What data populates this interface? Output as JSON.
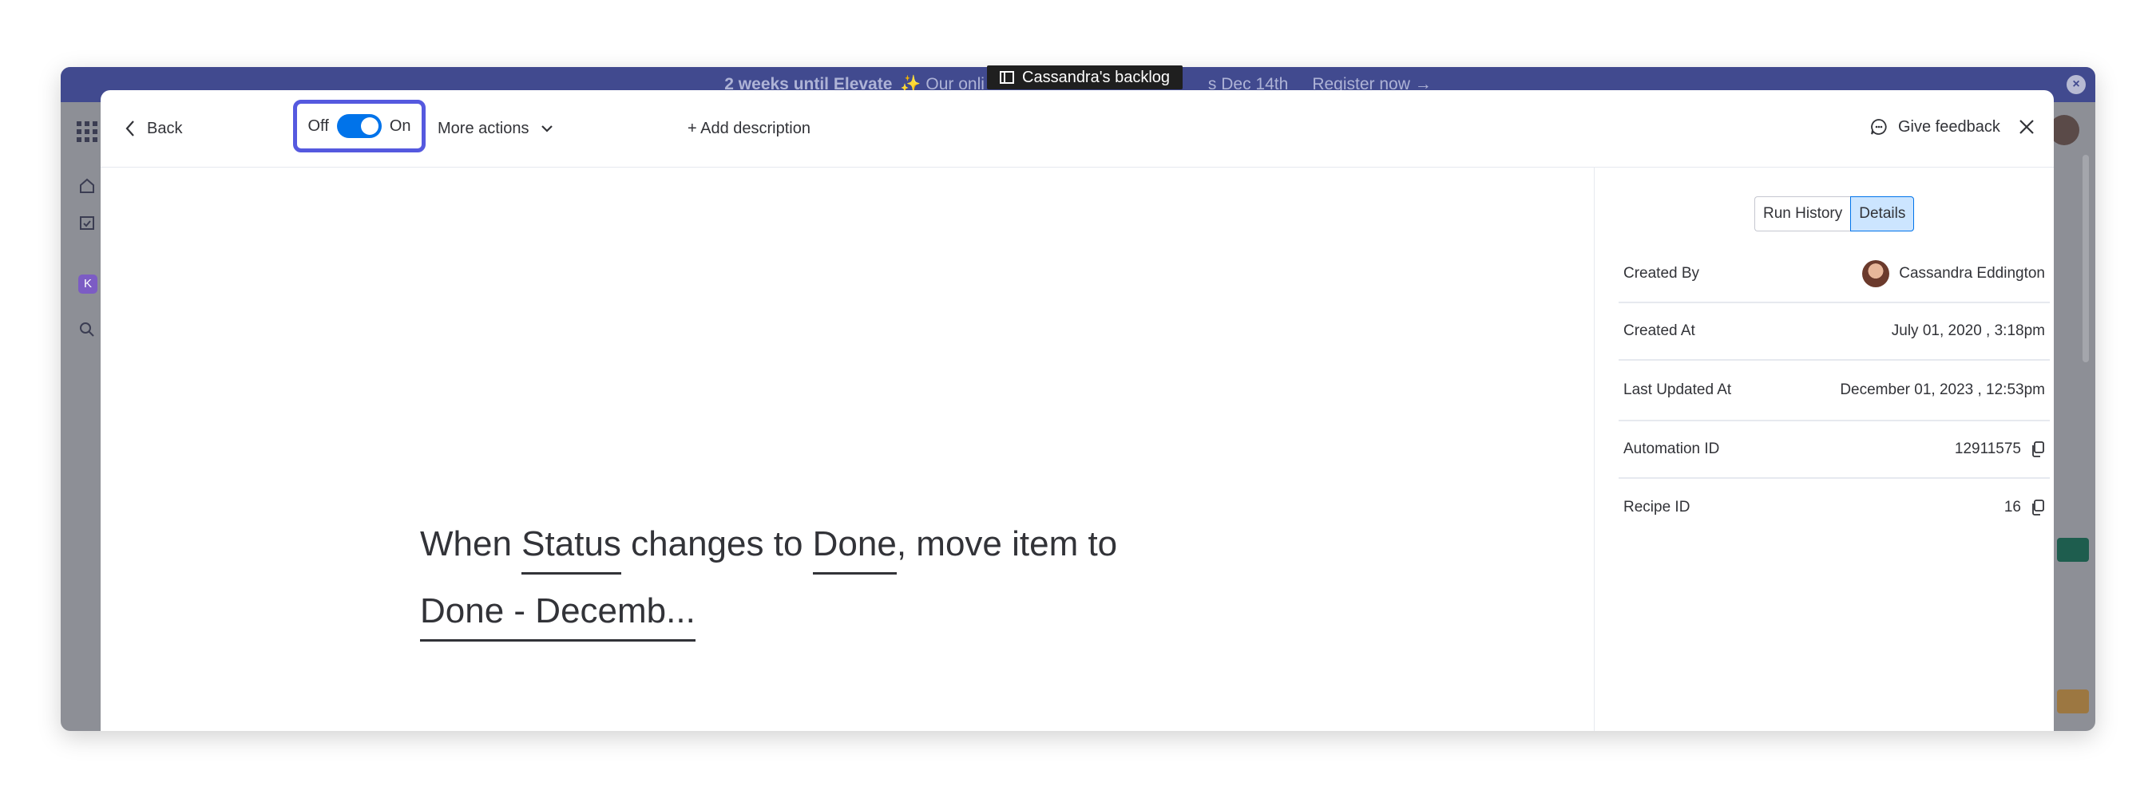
{
  "promo_banner": {
    "bold_text": "2 weeks until Elevate",
    "text": "✨ Our onli",
    "text_tail": "s Dec 14th",
    "register": "Register now →"
  },
  "board_tab": {
    "label": "Cassandra's backlog"
  },
  "header": {
    "back_label": "Back",
    "toggle_off_label": "Off",
    "toggle_on_label": "On",
    "toggle_state": "on",
    "more_actions_label": "More actions",
    "add_description_label": "+ Add description",
    "feedback_label": "Give feedback"
  },
  "recipe": {
    "part1": "When ",
    "trigger_column": "Status",
    "part2": " changes to ",
    "trigger_value": "Done",
    "part3": ", move item to",
    "target_group": "Done - Decemb..."
  },
  "details_panel": {
    "tabs": [
      {
        "label": "Run History",
        "active": false
      },
      {
        "label": "Details",
        "active": true
      }
    ],
    "rows": [
      {
        "label": "Created By",
        "value": "Cassandra Eddington"
      },
      {
        "label": "Created At",
        "value": "July 01, 2020 , 3:18pm"
      },
      {
        "label": "Last Updated At",
        "value": "December 01, 2023 , 12:53pm"
      },
      {
        "label": "Automation ID",
        "value": "12911575"
      },
      {
        "label": "Recipe ID",
        "value": "16"
      }
    ]
  },
  "colors": {
    "accent": "#0073ea",
    "highlight_border": "#5559df",
    "banner": "#414a8f",
    "active_tab_bg": "#cce5ff"
  }
}
